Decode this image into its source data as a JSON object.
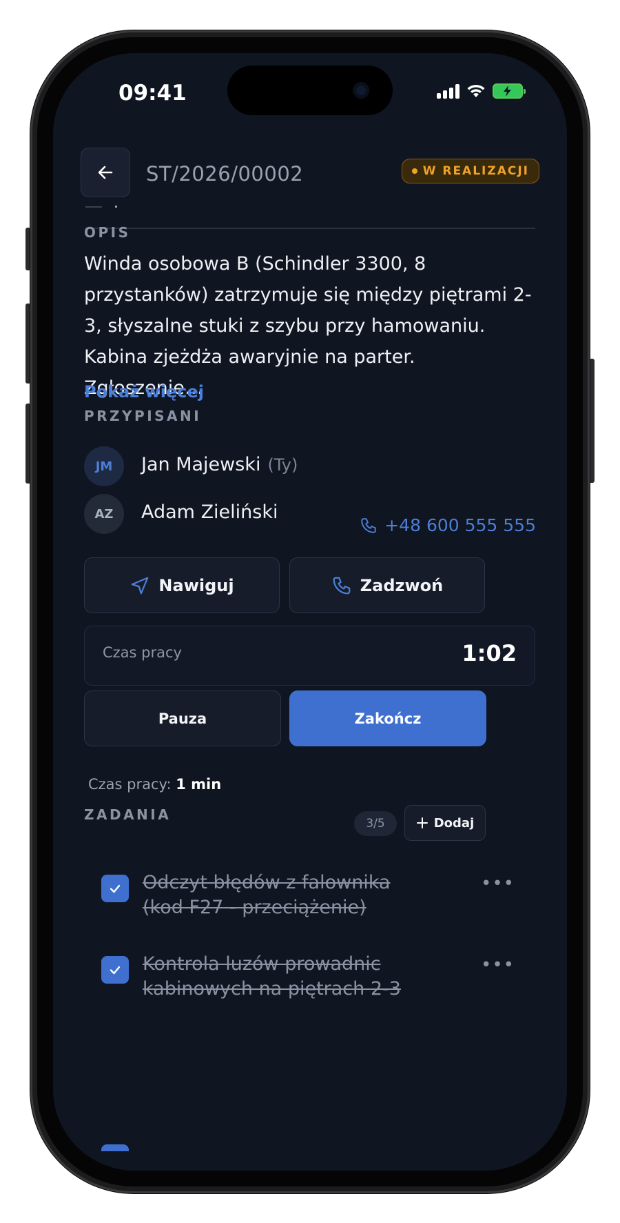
{
  "status_bar": {
    "time": "09:41"
  },
  "header": {
    "back_icon": "arrow-left-icon",
    "code": "ST/2026/00002",
    "status": "W REALIZACJI",
    "status_color": "#f0a22a"
  },
  "description": {
    "label": "OPIS",
    "text": "Winda osobowa B (Schindler 3300, 8 przystanków) zatrzymuje się między piętrami 2-3, słyszalne stuki z szybu przy hamowaniu. Kabina zjeżdża awaryjnie na parter. Zgłoszenie…",
    "show_more": "Pokaż więcej"
  },
  "assigned": {
    "label": "PRZYPISANI",
    "people": [
      {
        "initials": "JM",
        "name": "Jan Majewski",
        "you": "(Ty)"
      },
      {
        "initials": "AZ",
        "name": "Adam Zieliński",
        "phone": "+48 600 555 555"
      }
    ]
  },
  "actions": {
    "navigate": "Nawiguj",
    "call": "Zadzwoń"
  },
  "timer": {
    "label": "Czas pracy",
    "value": "1:02"
  },
  "controls": {
    "pause": "Pauza",
    "finish": "Zakończ"
  },
  "worktime": {
    "label": "Czas pracy:",
    "value": "1 min"
  },
  "tasks": {
    "label": "ZADANIA",
    "count": "3/5",
    "add": "Dodaj",
    "items": [
      {
        "text": "Odczyt błędów z falownika (kod F27 - przeciążenie)",
        "done": true
      },
      {
        "text": "Kontrola luzów prowadnic kabinowych na piętrach 2-3",
        "done": true
      }
    ]
  },
  "colors": {
    "accent": "#3f70cf",
    "link": "#4c7fd8",
    "background": "#0f1521"
  }
}
